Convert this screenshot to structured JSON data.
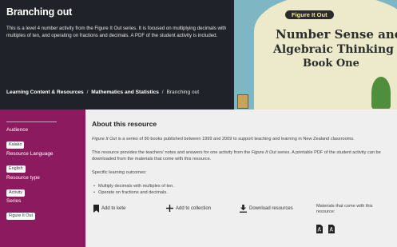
{
  "hero": {
    "title": "Branching out",
    "description": "This is a level 4 number activity from the Figure It Out series. It is focused on multiplying decimals with multiples of ten, and operating on fractions and decimals. A PDF of the student activity is included.",
    "breadcrumbs": [
      "Learning Content & Resources",
      "Mathematics and Statistics"
    ],
    "current": "Branching out",
    "separator": "/"
  },
  "cover": {
    "badge": "Figure It Out",
    "line1": "Number Sense and",
    "line2": "Algebraic Thinking",
    "line3": "Book One"
  },
  "sidebar": {
    "audience_label": "Audience",
    "audience_value": "Kaiako",
    "language_label": "Resource Language",
    "language_value": "English",
    "type_label": "Resource type",
    "type_value": "Activity",
    "series_label": "Series",
    "series_value": "Figure It Out"
  },
  "main": {
    "heading": "About this resource",
    "p1_em": "Figure It Out",
    "p1_rest": " is a series of 80 books published between 1999 and 2009 to support teaching and learning in New Zealand classrooms.",
    "p2_a": "This resource provides the teachers' notes and answers for one activity from the ",
    "p2_em": "Figure It Out",
    "p2_b": " series. A printable PDF of the student activity can be",
    "p2_c": "downloaded from the materials that come with this resource.",
    "outcomes_label": "Specific learning outcomes:",
    "outcomes": [
      "Multiply decimals with multiples of ten.",
      "Operate on fractions and decimals."
    ],
    "actions": {
      "kete": "Add to kete",
      "collection": "Add to collection",
      "download": "Download resources"
    },
    "materials_label_1": "Materials that come with this",
    "materials_label_2": "resource:"
  },
  "colors": {
    "hero_bg": "#1f2229",
    "sidebar_bg": "#8c1a5f",
    "main_bg": "#efefef"
  }
}
